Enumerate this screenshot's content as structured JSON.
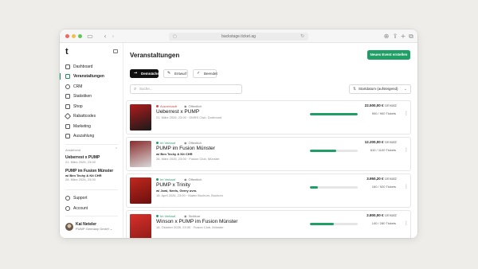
{
  "browser": {
    "url": "backstage.ticket.ag",
    "nav_back_icon": "chevron-left",
    "nav_forward_icon": "chevron-right"
  },
  "sidebar": {
    "logo": "t",
    "nav": [
      {
        "label": "Dashboard",
        "icon": "home-icon",
        "active": false
      },
      {
        "label": "Veranstaltungen",
        "icon": "calendar-icon",
        "active": true
      },
      {
        "label": "CRM",
        "icon": "users-icon",
        "active": false
      },
      {
        "label": "Statistiken",
        "icon": "chart-icon",
        "active": false
      },
      {
        "label": "Shop",
        "icon": "shop-icon",
        "active": false
      },
      {
        "label": "Rabattcodes",
        "icon": "tag-icon",
        "active": false
      },
      {
        "label": "Marketing",
        "icon": "megaphone-icon",
        "active": false
      },
      {
        "label": "Auszahlung",
        "icon": "wallet-icon",
        "active": false
      }
    ],
    "section_label": "Anstehend",
    "upcoming": [
      {
        "title": "Ueberrest x PUMP",
        "subtitle": "",
        "date": "21. März 2026, 23:00"
      },
      {
        "title": "PUMP im Fusion Münster",
        "subtitle": "w/ Ben Techy & Kit CHR",
        "date": "28. März 2026, 23:00"
      }
    ],
    "bottom": [
      {
        "label": "Support",
        "icon": "help-icon"
      },
      {
        "label": "Account",
        "icon": "account-icon"
      }
    ],
    "user": {
      "name": "Kai Neteler",
      "org": "PUMP Germany GmbH"
    }
  },
  "main": {
    "title": "Veranstaltungen",
    "new_event_label": "Neues Event erstellen",
    "tabs": [
      {
        "label": "Demnächst",
        "icon": "→",
        "active": true
      },
      {
        "label": "Entwurf",
        "icon": "✎",
        "active": false
      },
      {
        "label": "Beendet",
        "icon": "✓",
        "active": false
      }
    ],
    "search_placeholder": "Suche...",
    "sort_label": "Startdatum (aufsteigend)",
    "events": [
      {
        "status": "Ausverkauft",
        "status_color": "#e04343",
        "visibility": "Öffentlich",
        "title": "Ueberrest x PUMP",
        "subtitle": "",
        "meta": "21. März 2026, 23:00 · DMRS Club, Dortmund",
        "revenue": "22.500,00 €",
        "revenue_label": "Umsatz",
        "tickets": "900 / 900 Tickets",
        "progress": 1.0,
        "poster_colors": [
          "#b01b1b",
          "#1a1a1a"
        ]
      },
      {
        "status": "Im Verkauf",
        "status_color": "#1f9f66",
        "visibility": "Öffentlich",
        "title": "PUMP im Fusion Münster",
        "subtitle": "w/ Ben Techy & Kit CHR",
        "meta": "28. März 2026, 23:00 · Fusion Club, Münster",
        "revenue": "12.200,00 €",
        "revenue_label": "Umsatz",
        "tickets": "610 / 1100 Tickets",
        "progress": 0.55,
        "poster_colors": [
          "#8b2b2b",
          "#d9d9d9"
        ]
      },
      {
        "status": "Im Verkauf",
        "status_color": "#1f9f66",
        "visibility": "Öffentlich",
        "title": "PUMP x Trinity",
        "subtitle": "w/ Jowi, Neels, Geery uvm.",
        "meta": "18. April 2026, 23:00 · Matrix Bochum, Bochum",
        "revenue": "3.950,20 €",
        "revenue_label": "Umsatz",
        "tickets": "160 / 920 Tickets",
        "progress": 0.17,
        "poster_colors": [
          "#c0281d",
          "#6b0f0f"
        ]
      },
      {
        "status": "Im Verkauf",
        "status_color": "#1f9f66",
        "visibility": "Sichtbar",
        "title": "Winson x PUMP im Fusion Münster",
        "subtitle": "",
        "meta": "18. Oktober 2026, 23:00 · Fusion Club, Münster",
        "revenue": "2.800,00 €",
        "revenue_label": "Umsatz",
        "tickets": "140 / 280 Tickets",
        "progress": 0.5,
        "poster_colors": [
          "#d8302b",
          "#8e1b17"
        ]
      }
    ]
  }
}
